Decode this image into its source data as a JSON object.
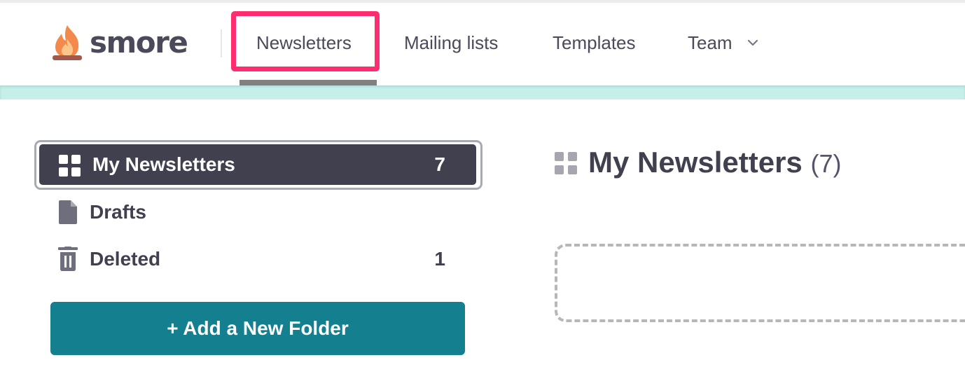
{
  "app": {
    "logo_text": "smore"
  },
  "nav": {
    "items": [
      {
        "label": "Newsletters",
        "active": true
      },
      {
        "label": "Mailing lists"
      },
      {
        "label": "Templates"
      },
      {
        "label": "Team",
        "has_dropdown": true
      }
    ]
  },
  "sidebar": {
    "items": [
      {
        "label": "My Newsletters",
        "count": "7",
        "icon": "grid-icon",
        "active": true
      },
      {
        "label": "Drafts",
        "count": "",
        "icon": "file-icon"
      },
      {
        "label": "Deleted",
        "count": "1",
        "icon": "trash-icon"
      }
    ],
    "add_folder_label": "+ Add a New Folder"
  },
  "main": {
    "title": "My Newsletters",
    "count": "(7)"
  },
  "colors": {
    "accent_pink": "#ff2d6f",
    "dark_slate": "#41404f",
    "teal_button": "#147f8e",
    "teal_band": "#c6efe9"
  }
}
